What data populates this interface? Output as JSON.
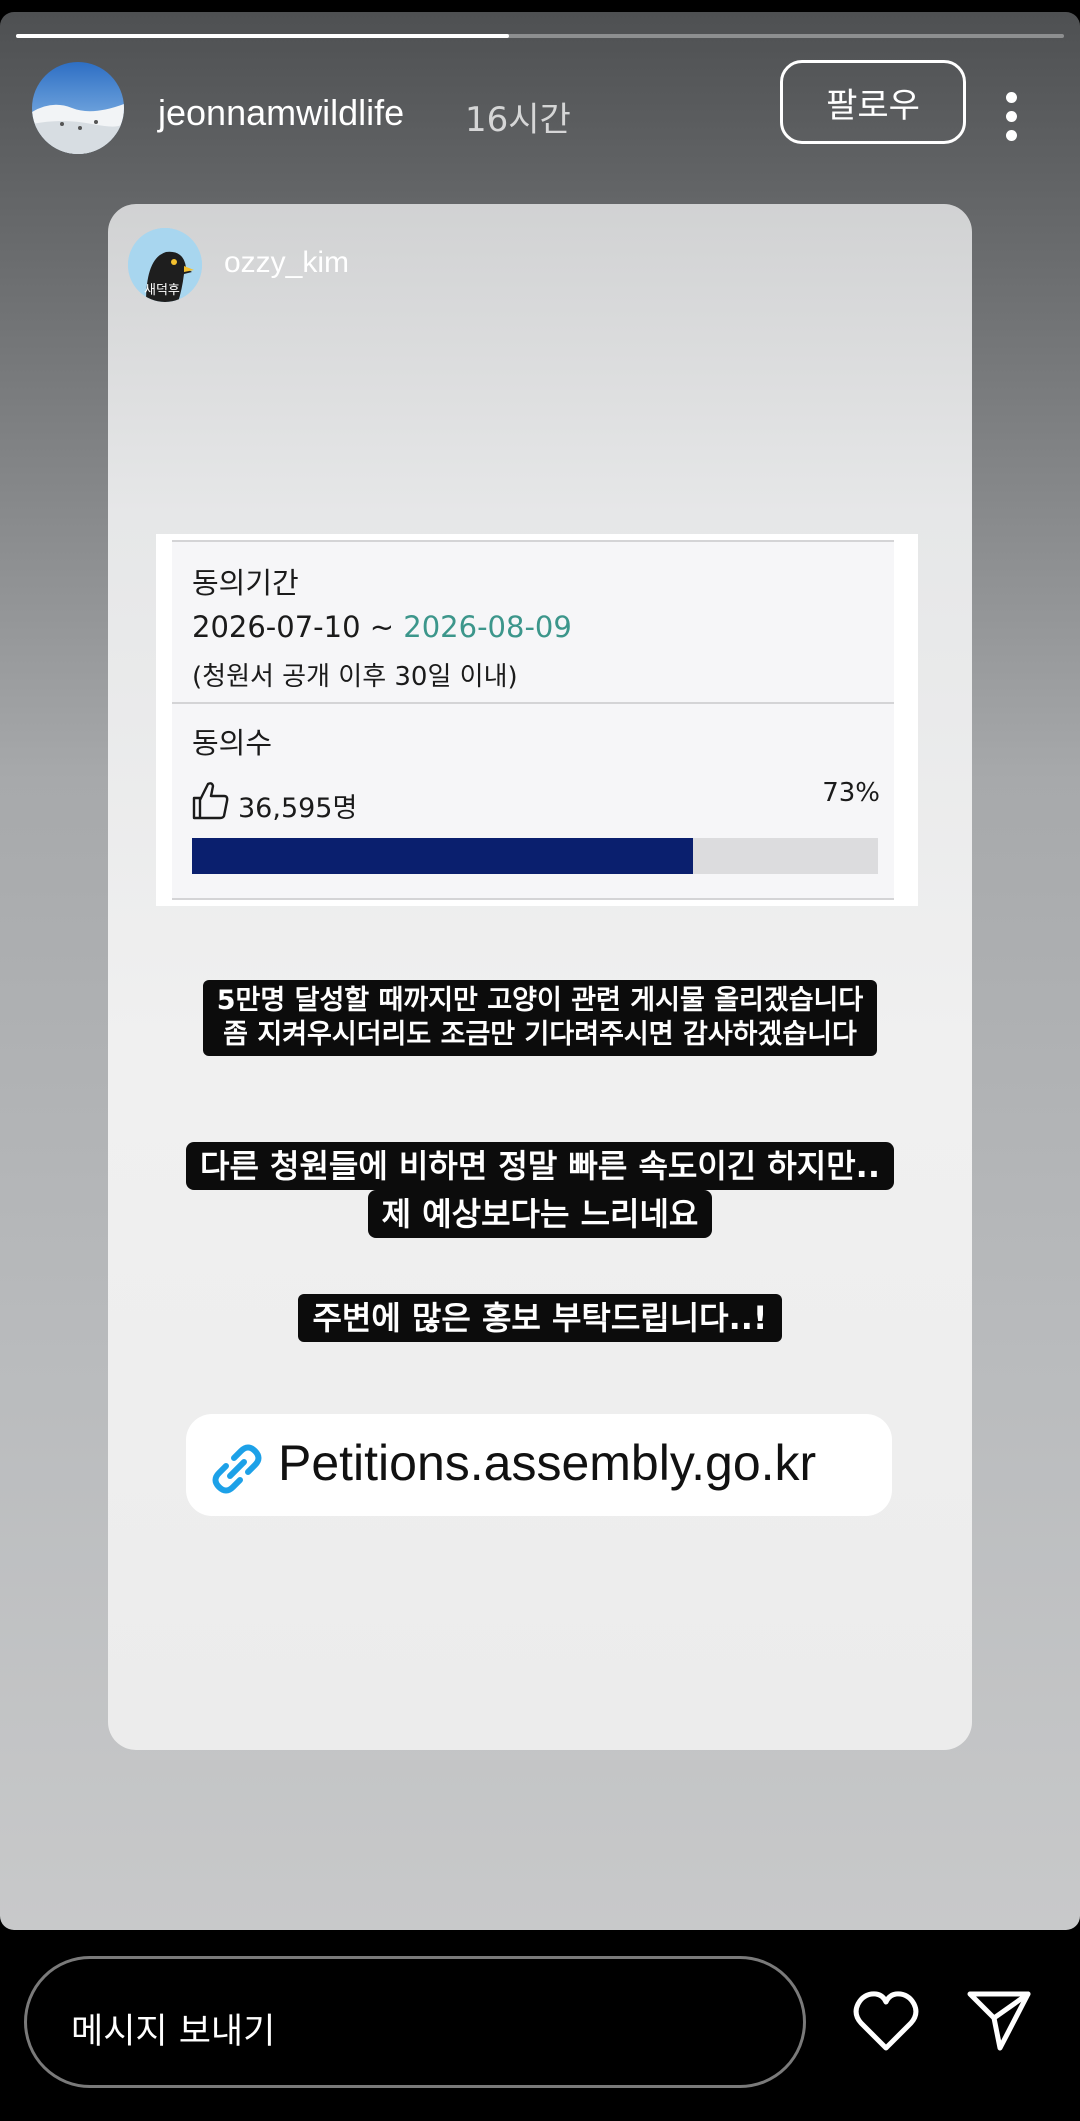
{
  "story": {
    "progress": 0.47
  },
  "header": {
    "username": "jeonnamwildlife",
    "time": "16시간",
    "follow_label": "팔로우",
    "more_icon": "more-vertical-icon"
  },
  "shared_post": {
    "username": "ozzy_kim",
    "avatar_text": "새덕후"
  },
  "petition": {
    "period_label": "동의기간",
    "date_start": "2026-07-10 ~ ",
    "date_end": "2026-08-09",
    "period_note": "(청원서 공개 이후 30일 이내)",
    "count_label": "동의수",
    "count_value": "36,595명",
    "percent_text": "73%",
    "percent_value": 0.73,
    "bar_color": "#0a1f6e"
  },
  "captions": {
    "line1a": "5만명 달성할 때까지만 고양이 관련 게시물 올리겠습니다",
    "line1b": "좀 지켜우시더리도 조금만 기다려주시면 감사하겠습니다",
    "line2a": "다른 청원들에 비하면 정말 빠른 속도이긴 하지만..",
    "line2b": "제 예상보다는 느리네요",
    "line3": "주변에 많은 홍보 부탁드립니다..!"
  },
  "link": {
    "text": "Petitions.assembly.go.kr",
    "icon": "link-icon",
    "icon_color": "#1da1e8"
  },
  "bottom": {
    "message_placeholder": "메시지 보내기",
    "like_icon": "heart-icon",
    "send_icon": "send-icon"
  }
}
